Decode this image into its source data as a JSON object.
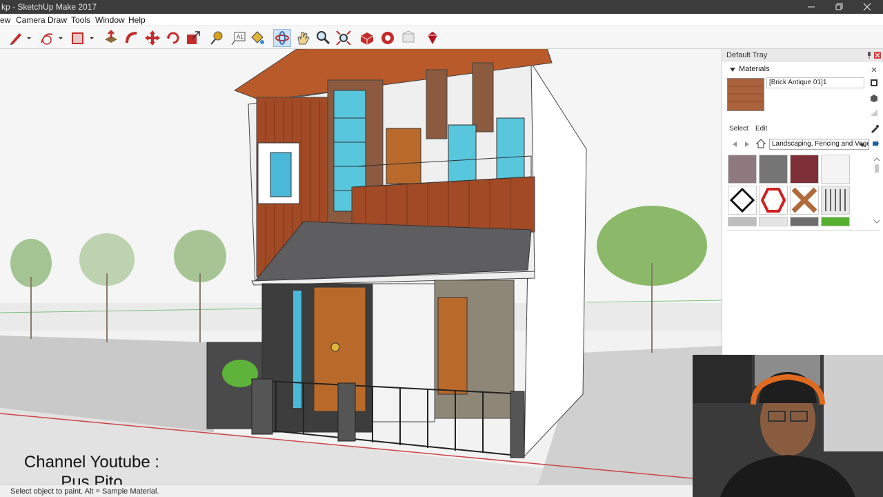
{
  "window": {
    "title": "kp - SketchUp Make 2017",
    "minimize_icon": "minimize-icon",
    "restore_icon": "restore-icon",
    "close_icon": "close-icon"
  },
  "menu": [
    "ew",
    "Camera",
    "Draw",
    "Tools",
    "Window",
    "Help"
  ],
  "toolbar": {
    "tools": [
      "pencil-icon",
      "dropdown-icon",
      "arc-icon",
      "dropdown-icon",
      "rectangle-icon",
      "dropdown-icon",
      "push-pull-icon",
      "follow-me-icon",
      "move-icon",
      "rotate-icon",
      "scale-icon",
      "tape-measure-icon",
      "text-icon",
      "paint-bucket-icon",
      "orbit-icon",
      "pan-icon",
      "zoom-icon",
      "zoom-extents-icon",
      "3d-warehouse-icon",
      "extension-warehouse-icon",
      "layout-icon",
      "ruby-icon"
    ],
    "active_tool": "orbit-icon"
  },
  "tray": {
    "title": "Default Tray",
    "panel": "Materials",
    "material_name": "[Brick Antique 01]1",
    "material_color": "#a9623c",
    "tabs": [
      "Select",
      "Edit"
    ],
    "library": "Landscaping, Fencing and Vege",
    "swatches": [
      {
        "color": "#8e7a7e"
      },
      {
        "color": "#757575"
      },
      {
        "color": "#7e2f37"
      },
      {
        "color": "#f4f4f4"
      },
      {
        "color": "#ffffff"
      },
      {
        "color": "#ffffff"
      },
      {
        "color": "#b06a3c"
      },
      {
        "color": "#e8e8e8"
      },
      {
        "color": "#bdbdbd"
      },
      {
        "color": "#e4e4e4"
      },
      {
        "color": "#6e6e6e"
      },
      {
        "color": "#56b030"
      }
    ]
  },
  "status": {
    "text": "Select object to paint. Alt = Sample Material."
  },
  "overlay": {
    "caption_line1": "Channel Youtube :",
    "caption_line2": "Pus Pito"
  }
}
